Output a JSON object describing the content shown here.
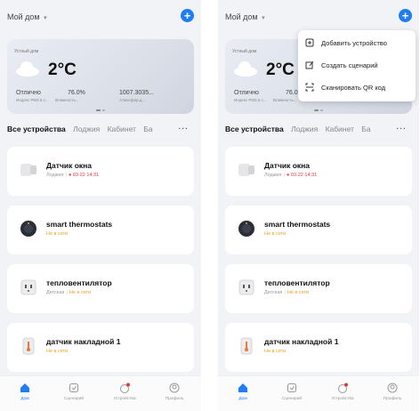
{
  "header": {
    "home_title": "Мой дом",
    "caret": "▾",
    "add_symbol": "+"
  },
  "weather": {
    "location": "Устный дом",
    "temperature": "2°C",
    "air_quality_value": "Отлично",
    "humidity_value": "76.0%",
    "pressure_value": "1007.3035...",
    "air_quality_label": "Индекс PM2.5 с...",
    "humidity_label": "Влажность...",
    "pressure_label": "Атмосфер.д..."
  },
  "tabs": {
    "items": [
      "Все устройства",
      "Лоджия",
      "Кабинет",
      "Ба"
    ],
    "more": "···"
  },
  "devices": [
    {
      "name": "Датчик окна",
      "room": "Лоджия",
      "alert": "03-22 14:31"
    },
    {
      "name": "smart thermostats",
      "status": "Не в сети"
    },
    {
      "name": "тепловентилятор",
      "room": "Детская",
      "status": "Не в сети"
    },
    {
      "name": "датчик накладной 1",
      "status": "Не в сети"
    }
  ],
  "nav": {
    "home": "Дом",
    "scenario": "Сценарий",
    "smart": "Устройства",
    "profile": "Профиль"
  },
  "menu": {
    "add_device": "Добавить устройство",
    "create_scenario": "Создать сценарий",
    "scan_qr": "Сканировать QR код"
  },
  "colors": {
    "accent": "#1f7ef5",
    "alert": "#e0383e",
    "offline": "#f0a020"
  }
}
